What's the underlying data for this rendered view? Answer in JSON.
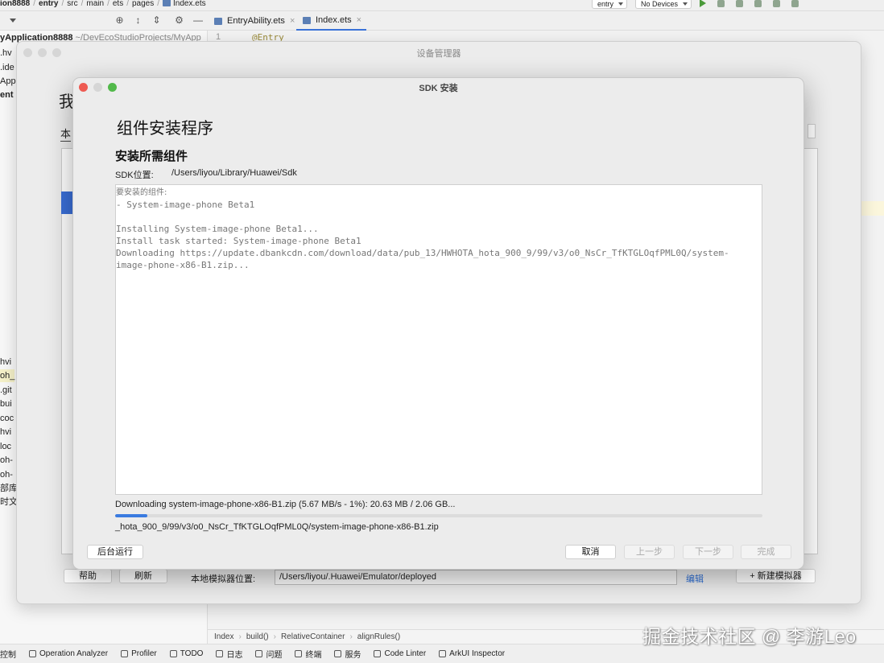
{
  "ide": {
    "breadcrumb": {
      "project": "ion8888",
      "module": "entry",
      "path": [
        "src",
        "main",
        "ets",
        "pages"
      ],
      "file": "Index.ets"
    },
    "run_bar": {
      "module": "entry",
      "device": "No Devices"
    },
    "editor_tabs": [
      {
        "label": "EntryAbility.ets"
      },
      {
        "label": "Index.ets"
      }
    ],
    "gutter_line": "1",
    "code_first_line": "@Entry",
    "project_root": {
      "name": "yApplication8888",
      "path": "~/DevEcoStudioProjects/MyApp"
    },
    "tree_items": [
      ".hv",
      ".ide",
      "App",
      "ent",
      "hvi",
      "oh_",
      ".git",
      "bui",
      "coc",
      "hvi",
      "loc",
      "oh-",
      "oh-",
      "部库",
      "时文"
    ],
    "code_breadcrumb": [
      "Index",
      "build()",
      "RelativeContainer",
      "alignRules()"
    ],
    "status_bar": [
      "控制",
      "Operation Analyzer",
      "Profiler",
      "TODO",
      "日志",
      "问题",
      "终端",
      "服务",
      "Code Linter",
      "ArkUI Inspector"
    ]
  },
  "device_manager": {
    "title": "设备管理器",
    "heading_partial": "我",
    "tab_partial": "本",
    "help_button": "帮助",
    "refresh_button": "刷新",
    "local_path_label": "本地模拟器位置:",
    "local_path_value": "/Users/liyou/.Huawei/Emulator/deployed",
    "edit_link": "编辑",
    "new_emulator_button": "+ 新建模拟器"
  },
  "sdk_dialog": {
    "title": "SDK 安装",
    "heading": "组件安装程序",
    "subheading": "安装所需组件",
    "sdk_location_label": "SDK位置:",
    "sdk_location_value": "/Users/liyou/Library/Huawei/Sdk",
    "log_lines": [
      "要安装的组件:",
      "- System-image-phone Beta1",
      "",
      "Installing System-image-phone Beta1...",
      "Install task started: System-image-phone Beta1",
      "Downloading https://update.dbankcdn.com/download/data/pub_13/HWHOTA_hota_900_9/99/v3/o0_NsCr_TfKTGLOqfPML0Q/system-",
      "image-phone-x86-B1.zip..."
    ],
    "status_text": "Downloading system-image-phone-x86-B1.zip (5.67 MB/s - 1%): 20.63 MB / 2.06 GB...",
    "progress_percent": 5,
    "file_path": "_hota_900_9/99/v3/o0_NsCr_TfKTGLOqfPML0Q/system-image-phone-x86-B1.zip",
    "buttons": {
      "background": "后台运行",
      "cancel": "取消",
      "previous": "上一步",
      "next": "下一步",
      "finish": "完成"
    },
    "colors": {
      "progress": "#3a7be0",
      "close": "#ee5a52",
      "zoom": "#52b94a"
    }
  },
  "watermark": "掘金技术社区 @ 李游Leo"
}
